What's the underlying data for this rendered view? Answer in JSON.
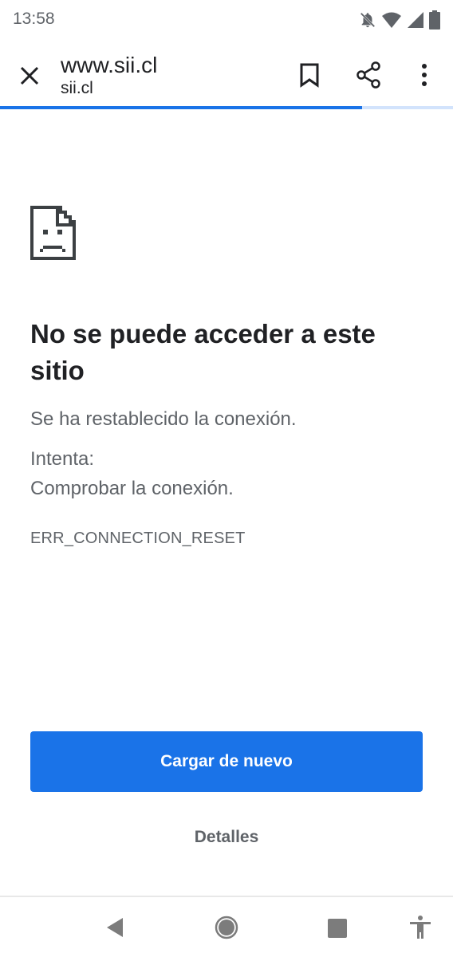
{
  "status_bar": {
    "time": "13:58",
    "icons": [
      "bell-off-icon",
      "wifi-icon",
      "signal-icon",
      "battery-icon"
    ]
  },
  "toolbar": {
    "title": "www.sii.cl",
    "subtitle": "sii.cl",
    "icons": [
      "close-icon",
      "bookmark-icon",
      "share-icon",
      "more-vert-icon"
    ],
    "load_progress_fraction": 0.8
  },
  "error_page": {
    "icon": "sad-page-icon",
    "heading": "No se puede acceder a este sitio",
    "description": "Se ha restablecido la conexión.",
    "try_label": "Intenta:",
    "try_items": [
      "Comprobar la conexión."
    ],
    "error_code": "ERR_CONNECTION_RESET",
    "reload_label": "Cargar de nuevo",
    "details_label": "Detalles"
  },
  "nav_bar": {
    "icons": [
      "back-icon",
      "home-icon",
      "recents-icon",
      "accessibility-icon"
    ]
  },
  "colors": {
    "accent": "#1a73e8",
    "text_primary": "#202124",
    "text_secondary": "#5f6368"
  }
}
